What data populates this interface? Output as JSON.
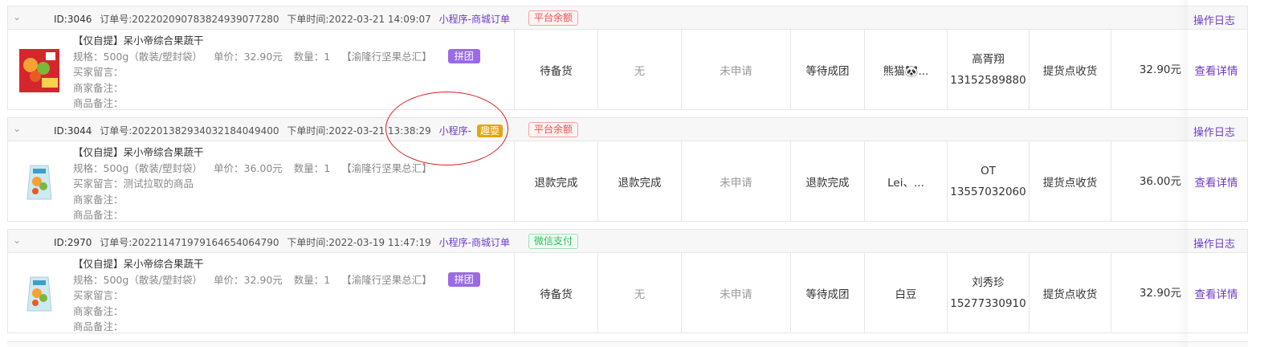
{
  "orders": [
    {
      "id": "ID:3046",
      "order_no": "订单号:2022020907838249390772​80",
      "order_time": "下单时间:2022-03-21 14:09:07",
      "channel": "小程序-商城订单",
      "channel_prefix": "",
      "channel_badge": "",
      "pay_method": "平台余额",
      "log_link": "操作日志",
      "product_name": "【仅自提】呆小帝综合果蔬干",
      "spec": "规格：500g（散装/塑封袋）",
      "price": "单价：32.90元",
      "qty": "数量：1",
      "store": "【渝隆行坚果总汇】",
      "tag": "拼团",
      "buyer_msg": "买家留言：",
      "merchant_note": "商家备注：",
      "product_note": "商品备注：",
      "status1": "待备货",
      "status2": "无",
      "refund": "未申请",
      "group_status": "等待成团",
      "nickname": "熊猫🐼...",
      "receiver_name": "高胥翔",
      "receiver_phone": "13152589880",
      "delivery": "提货点收货",
      "amount": "32.90元",
      "detail_link": "查看详情"
    },
    {
      "id": "ID:3044",
      "order_no": "订单号:2022013829340321840494​00",
      "order_time": "下单时间:2022-03-21 13:38:29",
      "channel": "",
      "channel_prefix": "小程序-",
      "channel_badge": "趣耍",
      "pay_method": "平台余额",
      "log_link": "操作日志",
      "product_name": "【仅自提】呆小帝综合果蔬干",
      "spec": "规格：500g（散装/塑封袋）",
      "price": "单价：36.00元",
      "qty": "数量：1",
      "store": "【渝隆行坚果总汇】",
      "tag": "",
      "buyer_msg": "买家留言：测试拉取的商品",
      "merchant_note": "商家备注：",
      "product_note": "商品备注：",
      "status1": "退款完成",
      "status2": "退款完成",
      "refund": "未申请",
      "group_status": "退款完成",
      "nickname": "Lei、...",
      "receiver_name": "OT",
      "receiver_phone": "13557032060",
      "delivery": "提货点收货",
      "amount": "36.00元",
      "detail_link": "查看详情"
    },
    {
      "id": "ID:2970",
      "order_no": "订单号:2022114719791646540647​90",
      "order_time": "下单时间:2022-03-19 11:47:19",
      "channel": "小程序-商城订单",
      "channel_prefix": "",
      "channel_badge": "",
      "pay_method": "微信支付",
      "log_link": "操作日志",
      "product_name": "【仅自提】呆小帝综合果蔬干",
      "spec": "规格：500g（散装/塑封袋）",
      "price": "单价：32.90元",
      "qty": "数量：1",
      "store": "【渝隆行坚果总汇】",
      "tag": "拼团",
      "buyer_msg": "买家留言：",
      "merchant_note": "商家备注：",
      "product_note": "商品备注：",
      "status1": "待备货",
      "status2": "无",
      "refund": "未申请",
      "group_status": "等待成团",
      "nickname": "白豆",
      "receiver_name": "刘秀珍",
      "receiver_phone": "15277330910",
      "delivery": "提货点收货",
      "amount": "32.90元",
      "detail_link": "查看详情"
    }
  ],
  "colors": {
    "accent": "#6f3cc9",
    "tag": "#9b6be3",
    "pay_red": "#ef4f4f",
    "pay_green": "#35b85a",
    "highlight_circle": "#d71f1f",
    "qu_badge": "#e3a514"
  },
  "icons": [
    "chevron-down-icon",
    "product-thumbnail-image"
  ]
}
